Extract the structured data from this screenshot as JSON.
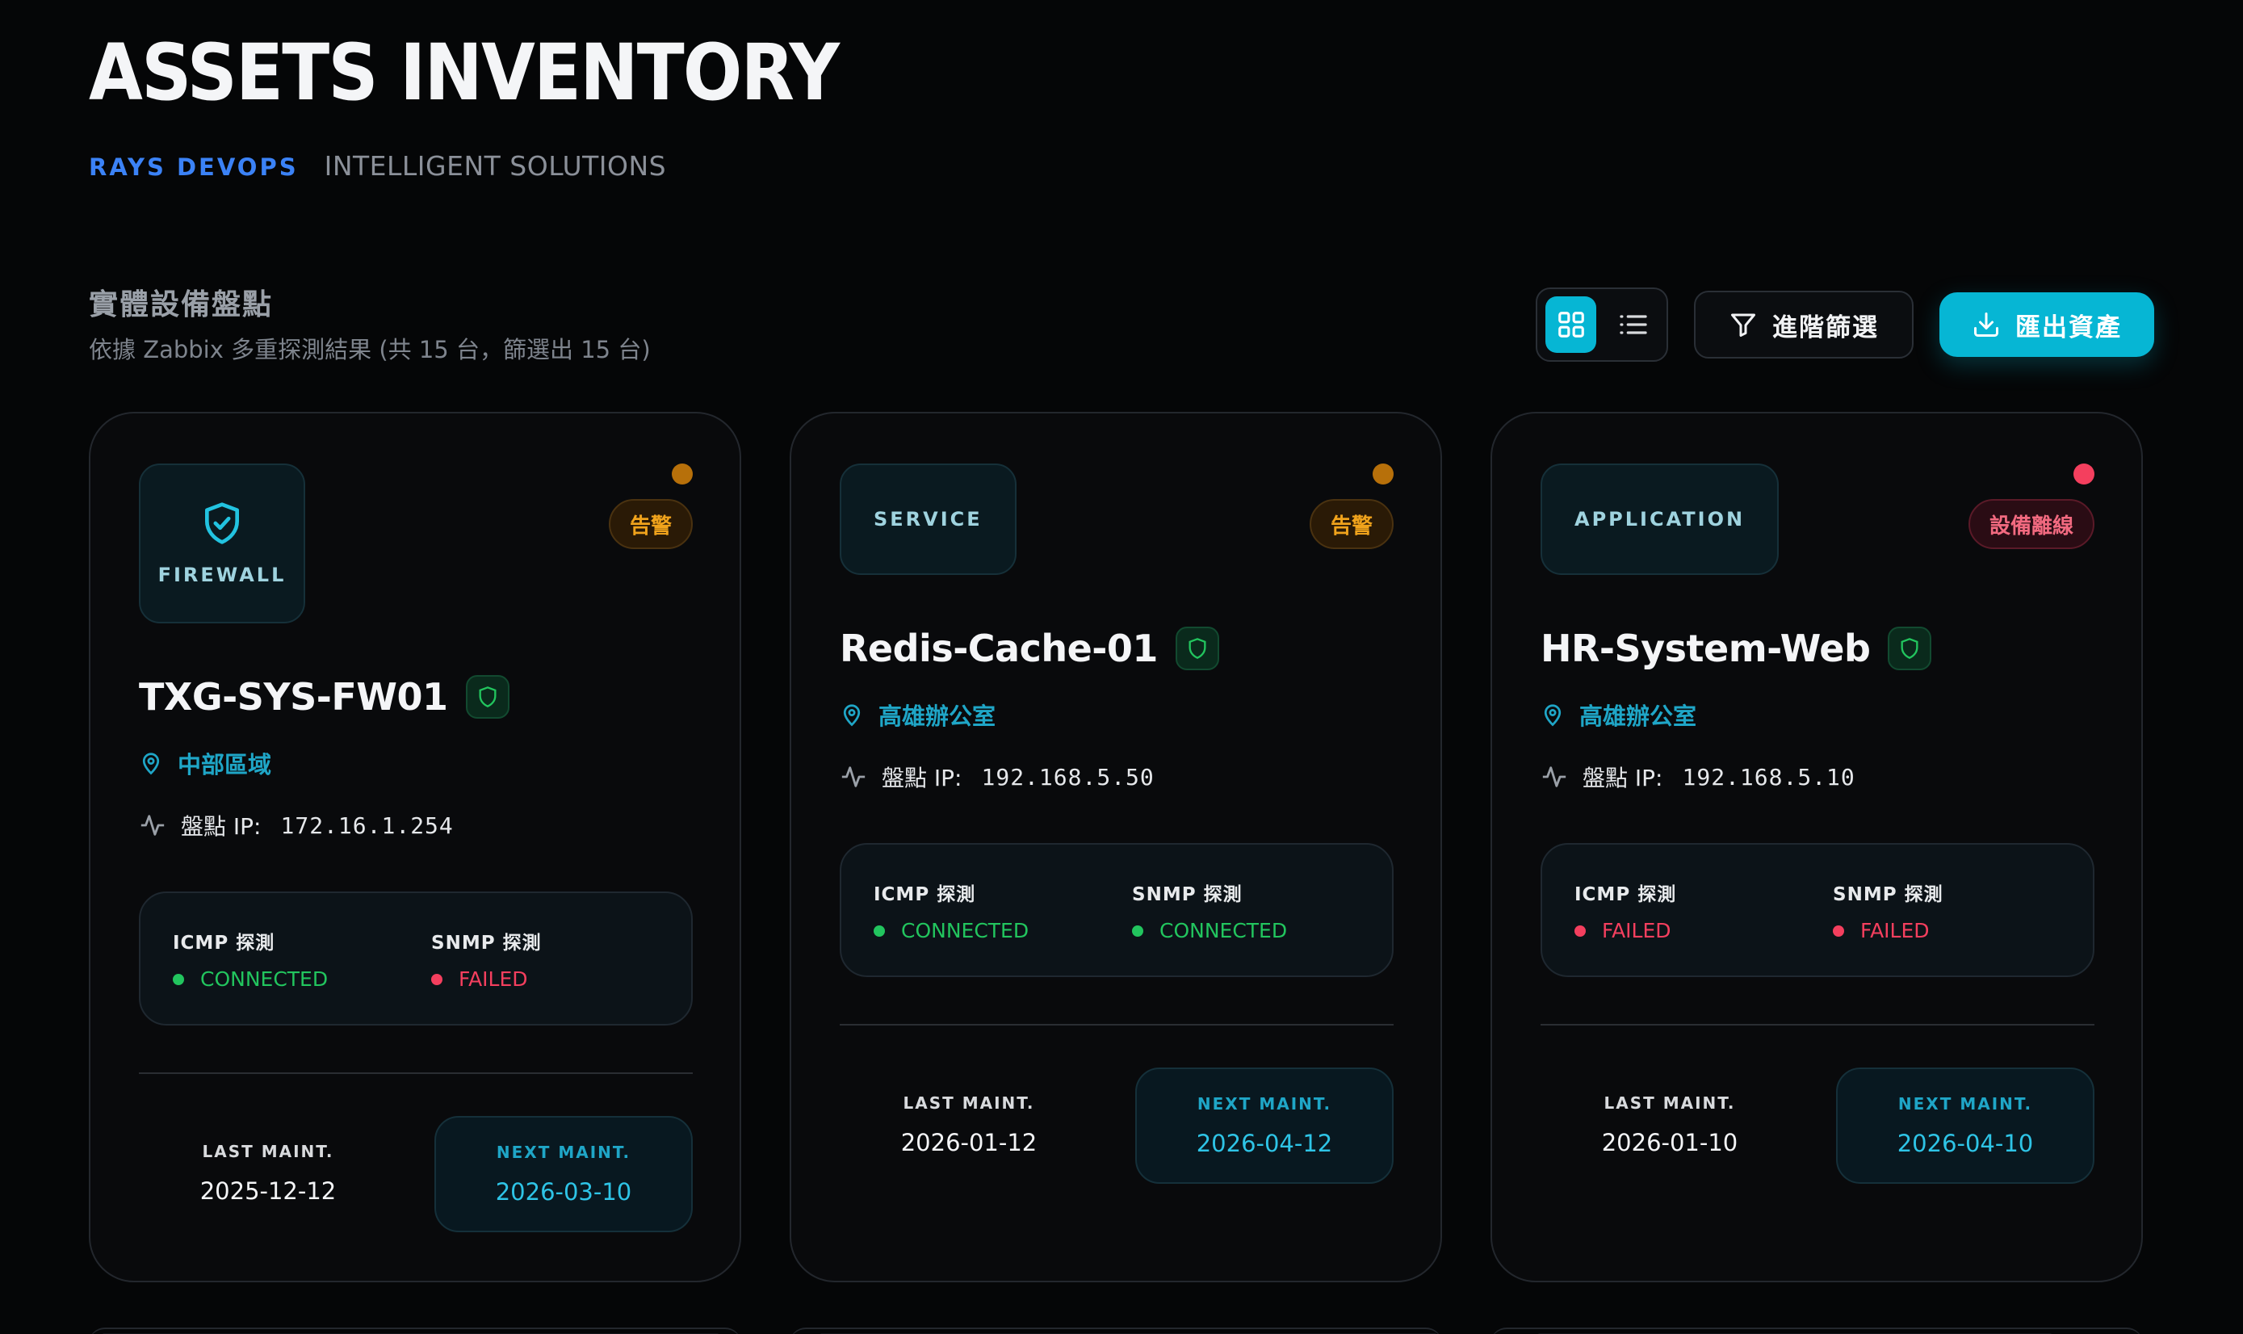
{
  "header": {
    "title": "ASSETS INVENTORY",
    "brand_primary": "RAYS DEVOPS",
    "brand_secondary": "INTELLIGENT SOLUTIONS"
  },
  "section": {
    "title": "實體設備盤點",
    "subtitle": "依據 Zabbix 多重探測結果 (共 15 台，篩選出 15 台)"
  },
  "toolbar": {
    "filter_label": "進階篩選",
    "export_label": "匯出資產",
    "active_view": "grid"
  },
  "labels": {
    "ip": "盤點 IP:",
    "icmp": "ICMP 探測",
    "snmp": "SNMP 探測",
    "last_maint": "LAST MAINT.",
    "next_maint": "NEXT MAINT."
  },
  "colors": {
    "accent": "#06b6d4",
    "brand": "#3b82f6",
    "ok": "#22c55e",
    "fail": "#f43f5e",
    "warn": "#f0a31c"
  },
  "cards": [
    {
      "type": "FIREWALL",
      "type_icon": "shield-check-icon",
      "status": "告警",
      "status_kind": "warn",
      "host": "TXG-SYS-FW01",
      "location": "中部區域",
      "ip": "172.16.1.254",
      "icmp": "CONNECTED",
      "snmp": "FAILED",
      "last_maint": "2025-12-12",
      "next_maint": "2026-03-10"
    },
    {
      "type": "SERVICE",
      "status": "告警",
      "status_kind": "warn",
      "host": "Redis-Cache-01",
      "location": "高雄辦公室",
      "ip": "192.168.5.50",
      "icmp": "CONNECTED",
      "snmp": "CONNECTED",
      "last_maint": "2026-01-12",
      "next_maint": "2026-04-12"
    },
    {
      "type": "APPLICATION",
      "status": "設備離線",
      "status_kind": "offline",
      "host": "HR-System-Web",
      "location": "高雄辦公室",
      "ip": "192.168.5.10",
      "icmp": "FAILED",
      "snmp": "FAILED",
      "last_maint": "2026-01-10",
      "next_maint": "2026-04-10"
    }
  ]
}
